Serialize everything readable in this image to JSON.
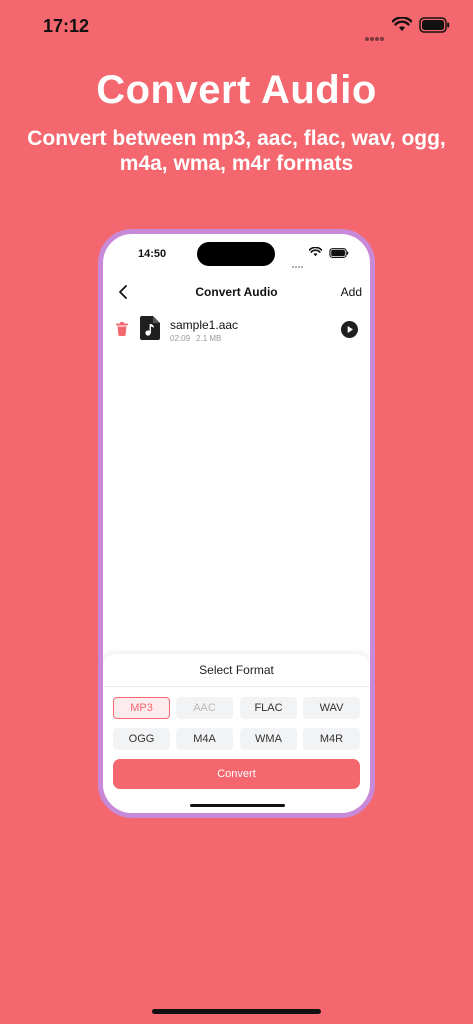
{
  "status_bar": {
    "time": "17:12"
  },
  "promo": {
    "headline": "Convert Audio",
    "subhead": "Convert between mp3, aac, flac, wav, ogg, m4a, wma, m4r formats"
  },
  "phone": {
    "status_time": "14:50",
    "nav": {
      "title": "Convert Audio",
      "add_label": "Add",
      "back_icon": "chevron-left-icon"
    },
    "files": [
      {
        "name": "sample1.aac",
        "duration": "02:09",
        "size": "2.1 MB"
      }
    ],
    "sheet": {
      "title": "Select Format",
      "formats": [
        {
          "label": "MP3",
          "state": "selected"
        },
        {
          "label": "AAC",
          "state": "disabled"
        },
        {
          "label": "FLAC",
          "state": "normal"
        },
        {
          "label": "WAV",
          "state": "normal"
        },
        {
          "label": "OGG",
          "state": "normal"
        },
        {
          "label": "M4A",
          "state": "normal"
        },
        {
          "label": "WMA",
          "state": "normal"
        },
        {
          "label": "M4R",
          "state": "normal"
        }
      ],
      "convert_label": "Convert"
    }
  },
  "colors": {
    "background": "#f4676e",
    "phone_frame": "#c88ad8",
    "accent": "#f4676e"
  }
}
